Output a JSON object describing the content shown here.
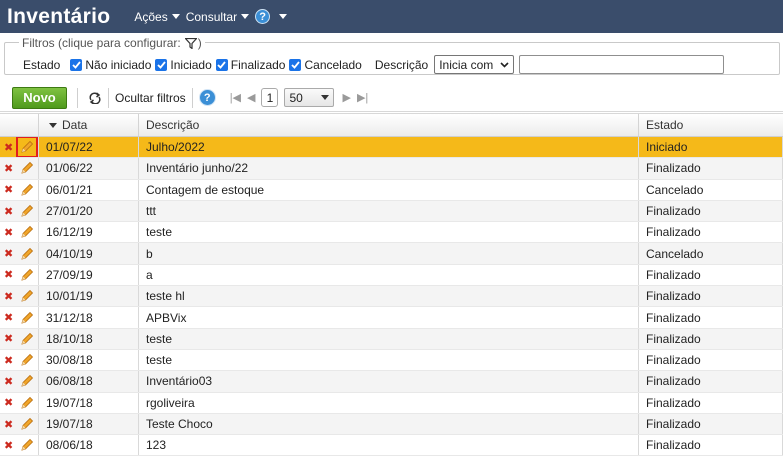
{
  "header": {
    "title": "Inventário",
    "menu": [
      {
        "label": "Ações"
      },
      {
        "label": "Consultar"
      }
    ],
    "help_label": "?"
  },
  "filters": {
    "legend": "Filtros (clique para configurar:",
    "legend_suffix": ")",
    "estado_label": "Estado",
    "checkboxes": [
      {
        "label": "Não iniciado",
        "checked": true
      },
      {
        "label": "Iniciado",
        "checked": true
      },
      {
        "label": "Finalizado",
        "checked": true
      },
      {
        "label": "Cancelado",
        "checked": true
      }
    ],
    "descricao_label": "Descrição",
    "descricao_mode": "Inicia com",
    "descricao_value": ""
  },
  "toolbar": {
    "new_label": "Novo",
    "hide_filters_label": "Ocultar filtros",
    "help_label": "?",
    "page": "1",
    "page_size": "50",
    "nav_first": "|◀",
    "nav_prev": "◀",
    "nav_next": "▶",
    "nav_last": "▶|"
  },
  "table": {
    "columns": [
      {
        "label": "Data"
      },
      {
        "label": "Descrição"
      },
      {
        "label": "Estado"
      }
    ],
    "rows": [
      {
        "date": "01/07/22",
        "desc": "Julho/2022",
        "state": "Iniciado"
      },
      {
        "date": "01/06/22",
        "desc": "Inventário junho/22",
        "state": "Finalizado"
      },
      {
        "date": "06/01/21",
        "desc": "Contagem de estoque",
        "state": "Cancelado"
      },
      {
        "date": "27/01/20",
        "desc": "ttt",
        "state": "Finalizado"
      },
      {
        "date": "16/12/19",
        "desc": "teste",
        "state": "Finalizado"
      },
      {
        "date": "04/10/19",
        "desc": "b",
        "state": "Cancelado"
      },
      {
        "date": "27/09/19",
        "desc": "a",
        "state": "Finalizado"
      },
      {
        "date": "10/01/19",
        "desc": "teste hl",
        "state": "Finalizado"
      },
      {
        "date": "31/12/18",
        "desc": "APBVix",
        "state": "Finalizado"
      },
      {
        "date": "18/10/18",
        "desc": "teste",
        "state": "Finalizado"
      },
      {
        "date": "30/08/18",
        "desc": "teste",
        "state": "Finalizado"
      },
      {
        "date": "06/08/18",
        "desc": "Inventário03",
        "state": "Finalizado"
      },
      {
        "date": "19/07/18",
        "desc": "rgoliveira",
        "state": "Finalizado"
      },
      {
        "date": "19/07/18",
        "desc": "Teste Choco",
        "state": "Finalizado"
      },
      {
        "date": "08/06/18",
        "desc": "123",
        "state": "Finalizado"
      }
    ]
  },
  "colors": {
    "header_bg": "#3a4d6b",
    "selected_row": "#f5b919",
    "new_button": "#5aa524",
    "highlight_box": "#e11d1d"
  }
}
